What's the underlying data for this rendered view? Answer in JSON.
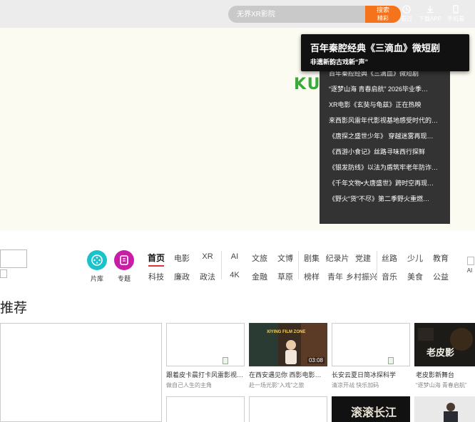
{
  "header": {
    "search_placeholder": "无界XR影院",
    "search_button": [
      "搜索",
      "精彩"
    ],
    "icons": [
      {
        "name": "history-icon",
        "label": "看过"
      },
      {
        "name": "download-icon",
        "label": "下载APP"
      },
      {
        "name": "phone-icon",
        "label": "手机看"
      }
    ]
  },
  "logo": "KUQIMAO.COM",
  "popup": {
    "title": "百年秦腔经典《三滴血》微短剧",
    "subtitle": "非遗新韵古戏新“声”"
  },
  "news": [
    "百年秦腔经典《三滴血》微短剧",
    "“逐梦山海 青春启航” 2026毕业季…",
    "XR电影《玄奘与龟兹》正在热映",
    "来西影风雷年代影视基地感受时代的…",
    "《唐探之盛世少年》 穿越迷雾再现…",
    "《西游小食记》丝路寻味西行探鲜",
    "《银发防线》以法为盾筑牢老年防诈…",
    "《千年文物•大唐盛世》跨时空再现…",
    "《野火“货”不尽》第二季野火重燃…"
  ],
  "nav": {
    "quick": [
      {
        "label": "片库",
        "color": "#19c3c9"
      },
      {
        "label": "专题",
        "color": "#c81ea6"
      }
    ],
    "row1": [
      "首页",
      "电影",
      "XR",
      "AI",
      "文旅",
      "文博",
      "剧集",
      "纪录片",
      "党建",
      "丝路",
      "少儿",
      "教育"
    ],
    "row2": [
      "科技",
      "廉政",
      "政法",
      "4K",
      "金融",
      "草原",
      "榜样",
      "青年",
      "乡村振兴",
      "音乐",
      "美食",
      "公益"
    ],
    "edge_label": "AI"
  },
  "recommend": {
    "title": "推荐",
    "cards": [
      {
        "title": "跟着皮卡晨打卡风雷影视…",
        "sub": "做自己人生的主角"
      },
      {
        "title": "在西安遇见你 西影电影…",
        "sub": "赴一场光影“入戏”之旅",
        "duration": "03:08",
        "thumb_text": "XIYING FILM ZONE"
      },
      {
        "title": "长安云夏日简冰探科学",
        "sub": "清凉开战 快乐加码"
      },
      {
        "title": "老皮影新舞台",
        "sub": "“逐梦山海 青春启航”",
        "thumb_text": "老皮影"
      }
    ],
    "row2_thumb_text": "滚滚长江"
  }
}
